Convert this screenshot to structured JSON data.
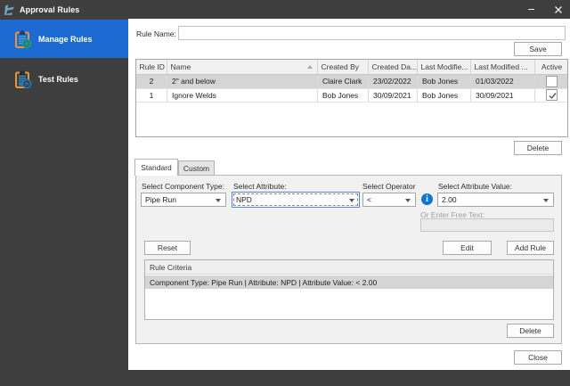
{
  "window": {
    "title": "Approval Rules",
    "minimize_icon": "minimize",
    "close_icon": "x"
  },
  "sidebar": {
    "items": [
      {
        "label": "Manage Rules",
        "icon": "clipboard-plus",
        "selected": true
      },
      {
        "label": "Test Rules",
        "icon": "clipboard-play",
        "selected": false
      }
    ]
  },
  "main": {
    "rule_name_label": "Rule Name:",
    "rule_name_value": "",
    "save_label": "Save",
    "grid": {
      "columns": [
        "Rule ID",
        "Name",
        "Created By",
        "Created Da...",
        "Last Modifie...",
        "Last Modified ...",
        "Active"
      ],
      "rows": [
        {
          "rule_id": "2",
          "name": "2\" and below",
          "created_by": "Claire Clark",
          "created_date": "23/02/2022",
          "last_modified_by": "Bob Jones",
          "last_modified_date": "01/03/2022",
          "active": false,
          "selected": true
        },
        {
          "rule_id": "1",
          "name": "Ignore Welds",
          "created_by": "Bob Jones",
          "created_date": "30/09/2021",
          "last_modified_by": "Bob Jones",
          "last_modified_date": "30/09/2021",
          "active": true,
          "selected": false
        }
      ]
    },
    "grid_delete_label": "Delete",
    "tabs": [
      {
        "label": "Standard",
        "active": true
      },
      {
        "label": "Custom",
        "active": false
      }
    ],
    "panel": {
      "component_type_label": "Select Component Type:",
      "component_type_value": "Pipe Run",
      "attribute_label": "Select Attribute:",
      "attribute_value": "NPD",
      "operator_label": "Select Operator",
      "operator_value": "<",
      "info_icon_glyph": "i",
      "attribute_value_label": "Select Attribute Value:",
      "attribute_value_value": "2.00",
      "free_text_label": "Or Enter Free Text:",
      "free_text_value": "",
      "reset_label": "Reset",
      "edit_label": "Edit",
      "add_rule_label": "Add Rule",
      "criteria_header": "Rule Criteria",
      "criteria_rows": [
        {
          "text": "Component Type: Pipe Run | Attribute: NPD | Attribute Value: < 2.00",
          "selected": true
        }
      ],
      "criteria_delete_label": "Delete"
    },
    "close_label": "Close"
  },
  "colors": {
    "titlebar": "#3e3e3e",
    "sidebar": "#3e3e3e",
    "selected_nav": "#1d6bd2",
    "content_bg": "#ffffff",
    "panel_bg": "#f1f1f1",
    "selected_row": "#d5d5d5",
    "focus_border": "#4f8cd9",
    "info_icon": "#0e76d1",
    "clipboard_frame": "#e8963a",
    "clipboard_lines": "#2e86c1",
    "badge_green": "#2da44e",
    "badge_blue": "#2279c4"
  }
}
